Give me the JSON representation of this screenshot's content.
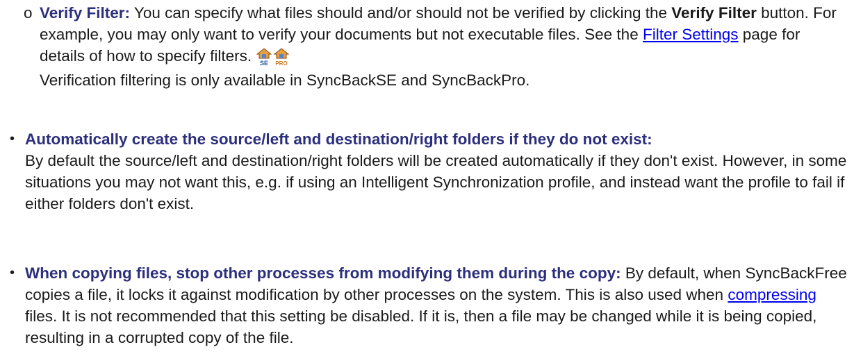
{
  "verify_filter": {
    "marker": "o",
    "term": "Verify Filter:",
    "text_1": " You can specify what files should and/or should not be verified by clicking the ",
    "button_name": "Verify Filter",
    "text_2": " button. For example, you may only want to verify your documents but not executable files. See the ",
    "link_label": "Filter Settings",
    "text_3": " page for details of how to specify filters.",
    "icons": [
      "syncbackse-edition-icon",
      "syncbackpro-edition-icon"
    ],
    "icon_labels": [
      "SE",
      "PRO"
    ],
    "text_4": "Verification filtering is only available in SyncBackSE and SyncBackPro."
  },
  "auto_create": {
    "bullet": "•",
    "term": "Automatically create the source/left and destination/right folders if they do not exist:",
    "text": "By default the source/left and destination/right folders will be created automatically if they don't exist. However, in some situations you may not want this, e.g. if using an Intelligent Synchronization profile, and instead want the profile to fail if either folders don't exist."
  },
  "lock_files": {
    "bullet": "•",
    "term": "When copying files, stop other processes from modifying them during the copy:",
    "text_1": " By default, when SyncBackFree copies a file, it locks it against modification by other processes on the system. This is also used when ",
    "link_label": "compressing",
    "text_2": " files. It is not recommended that this setting be disabled. If it is, then a file may be changed while it is being copied, resulting in a corrupted copy of the file."
  },
  "colors": {
    "term": "#2c2f7c",
    "link": "#0000ee",
    "text": "#1a1a1a",
    "icon_house": "#c8781e",
    "icon_label": "#1a4fa0"
  }
}
